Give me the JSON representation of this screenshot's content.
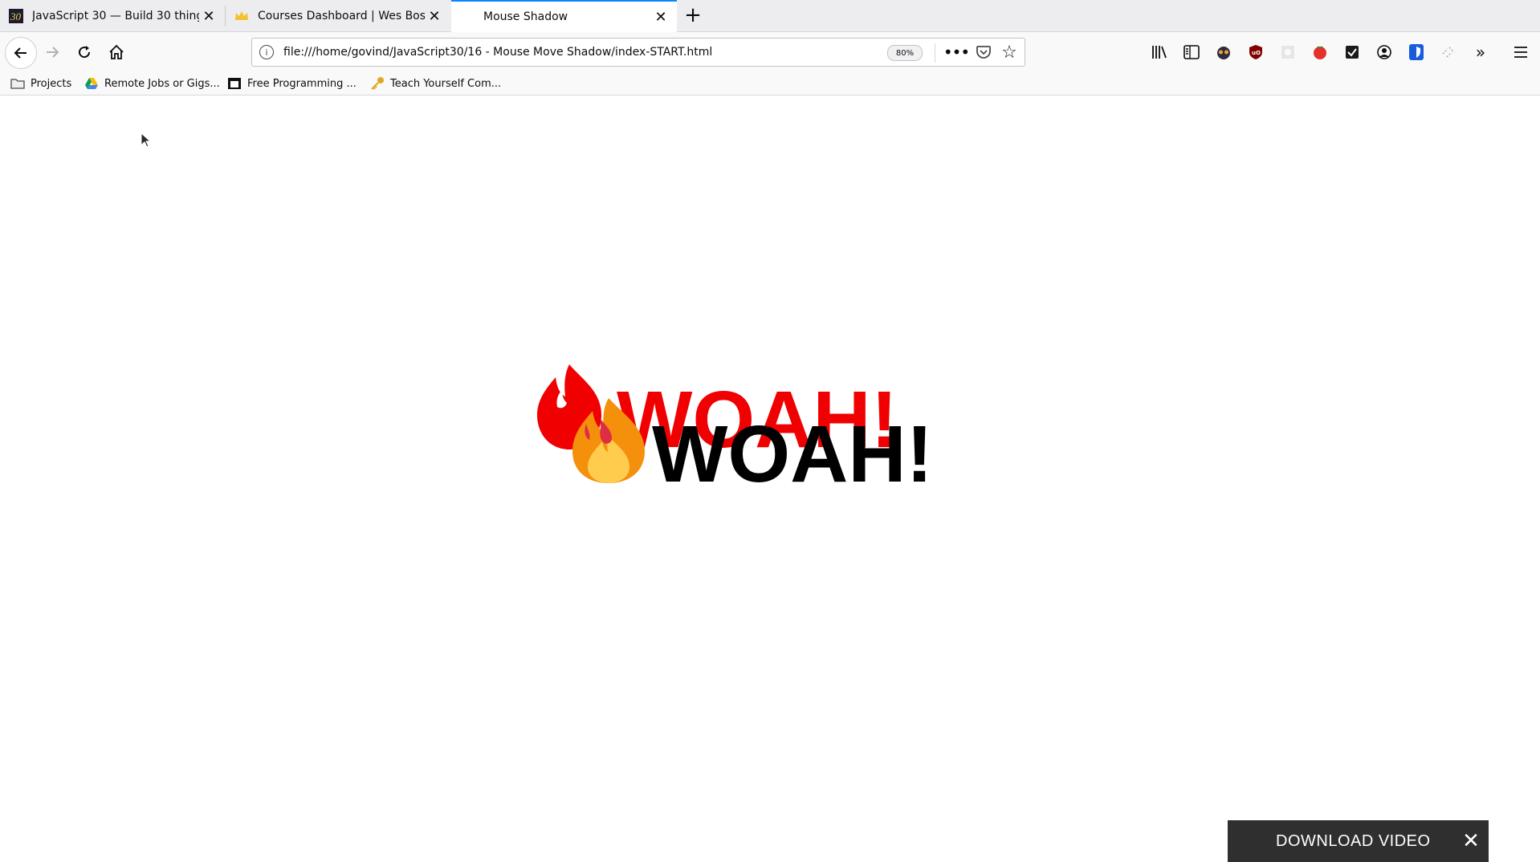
{
  "tabs": [
    {
      "title": "JavaScript 30 — Build 30 things wi",
      "favicon": "javascript30-icon",
      "active": false
    },
    {
      "title": "Courses Dashboard | Wes Bos",
      "favicon": "crown-icon",
      "active": false
    },
    {
      "title": "Mouse Shadow",
      "favicon": "",
      "active": true
    }
  ],
  "urlbar": {
    "url": "file:///home/govind/JavaScript30/16 - Mouse Move Shadow/index-START.html",
    "zoom": "80%"
  },
  "bookmarks": [
    {
      "label": "Projects",
      "icon": "folder-icon"
    },
    {
      "label": "Remote Jobs or Gigs...",
      "icon": "drive-icon"
    },
    {
      "label": "Free Programming ...",
      "icon": "site-icon"
    },
    {
      "label": "Teach Yourself Com...",
      "icon": "key-icon"
    }
  ],
  "hero": {
    "text": "WOAH!",
    "shadow_color": "#f00000",
    "text_color": "#000000",
    "emoji": "fire"
  },
  "overlay": {
    "label": "DOWNLOAD VIDEO"
  },
  "colors": {
    "accent": "#0a84ff",
    "tabstrip": "#ededf0",
    "toolbar": "#f9f9fa"
  }
}
